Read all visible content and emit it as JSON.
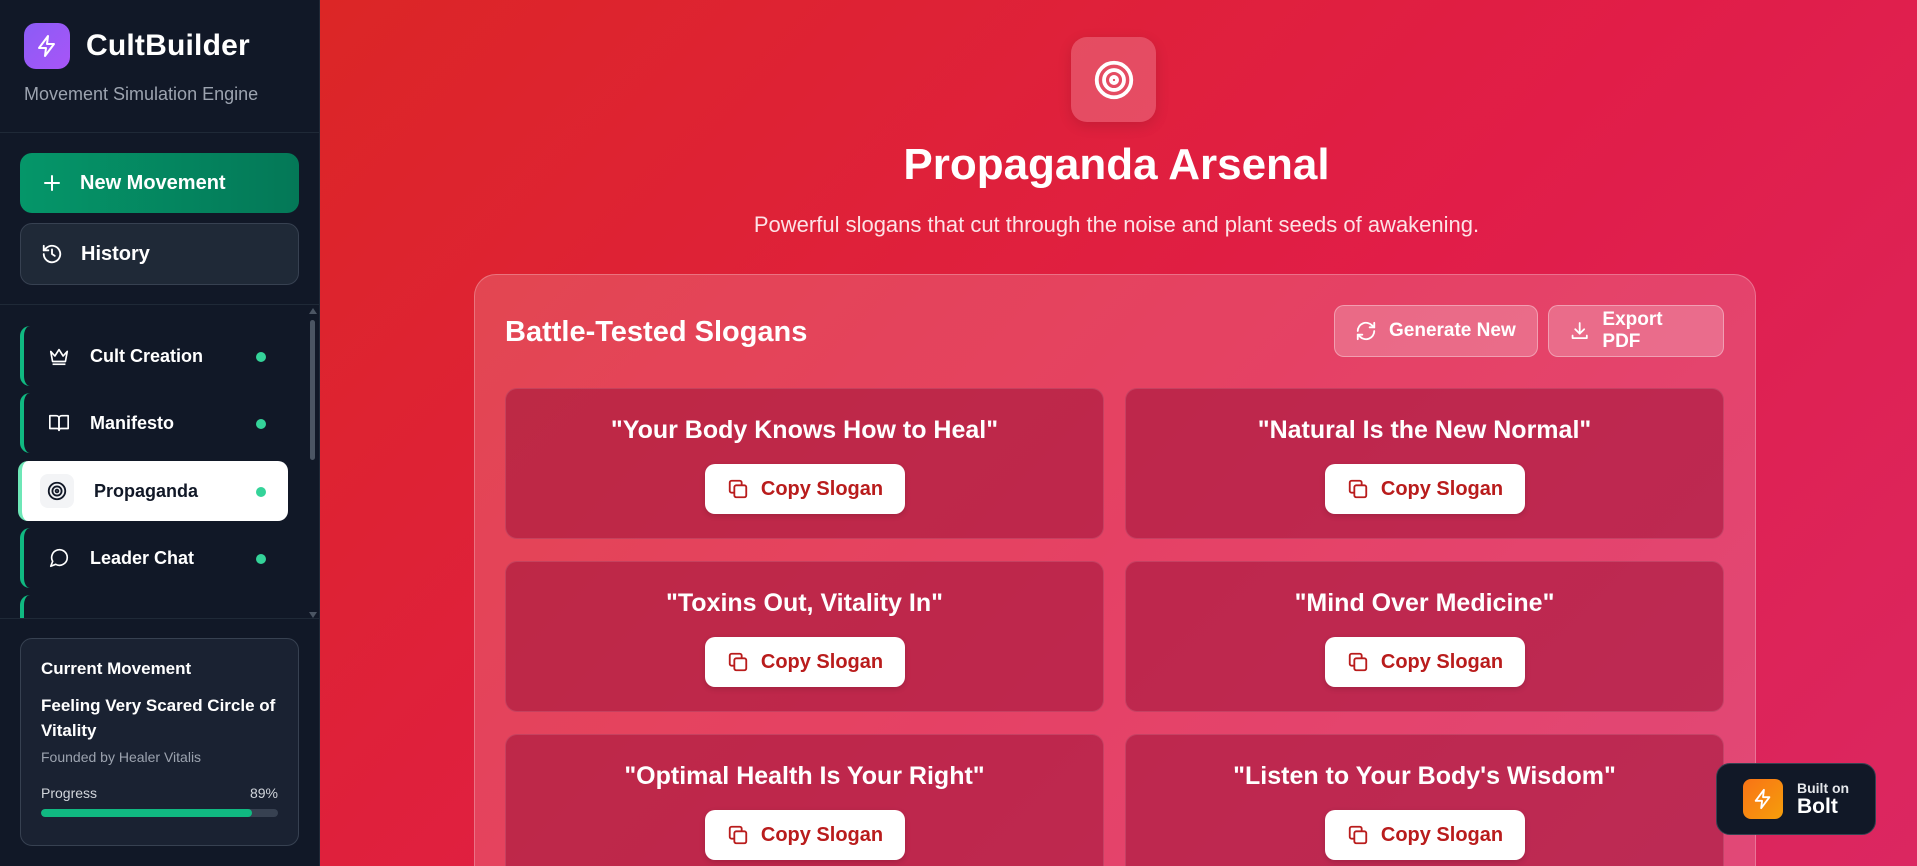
{
  "app": {
    "name": "CultBuilder",
    "subtitle": "Movement Simulation Engine"
  },
  "sidebar": {
    "new_movement_label": "New Movement",
    "history_label": "History",
    "nav_items": [
      {
        "label": "Cult Creation",
        "icon": "crown-icon"
      },
      {
        "label": "Manifesto",
        "icon": "book-icon"
      },
      {
        "label": "Propaganda",
        "icon": "target-icon",
        "active": true
      },
      {
        "label": "Leader Chat",
        "icon": "chat-icon"
      }
    ],
    "current_movement": {
      "heading": "Current Movement",
      "name": "Feeling Very Scared Circle of Vitality",
      "founder": "Founded by Healer Vitalis",
      "progress_label": "Progress",
      "progress_text": "89%",
      "progress_value": 0.89
    }
  },
  "main": {
    "title": "Propaganda Arsenal",
    "subtitle": "Powerful slogans that cut through the noise and plant seeds of awakening.",
    "panel": {
      "title": "Battle-Tested Slogans",
      "generate_label": "Generate New",
      "export_label": "Export PDF",
      "copy_label": "Copy Slogan",
      "slogans": [
        "\"Your Body Knows How to Heal\"",
        "\"Natural Is the New Normal\"",
        "\"Toxins Out, Vitality In\"",
        "\"Mind Over Medicine\"",
        "\"Optimal Health Is Your Right\"",
        "\"Listen to Your Body's Wisdom\""
      ]
    }
  },
  "badge": {
    "line1": "Built on",
    "line2": "Bolt"
  },
  "colors": {
    "accent_green": "#10b981",
    "main_red": "#e11d48",
    "sidebar_bg": "#111827",
    "brand_purple": "#8b5cf6"
  }
}
